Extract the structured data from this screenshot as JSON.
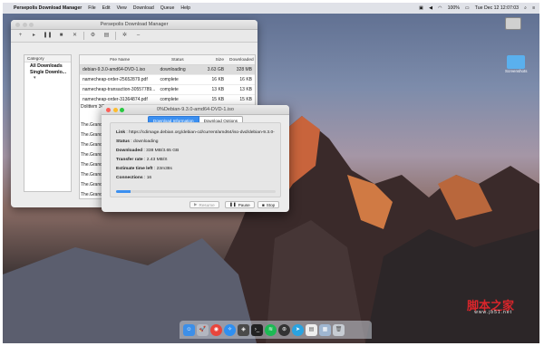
{
  "menubar": {
    "app": "Persepolis Download Manager",
    "items": [
      "File",
      "Edit",
      "View",
      "Download",
      "Queue",
      "Help"
    ],
    "battery": "100%",
    "clock": "Tue Dec 12  12:07:03"
  },
  "desktop": {
    "icons": [
      {
        "label": ""
      },
      {
        "label": "Screenshots"
      }
    ]
  },
  "main_window": {
    "title": "Persepolis Download Manager",
    "toolbar": [
      "add-icon",
      "resume-icon",
      "pause-icon",
      "stop-icon",
      "remove-icon",
      "properties-icon",
      "graph-icon",
      "settings-icon",
      "minimize-icon"
    ],
    "sidebar": {
      "header": "Category",
      "items": [
        "All Downloads",
        "Single Downlo..."
      ],
      "arrow": "▾"
    },
    "table": {
      "columns": [
        "File Name",
        "Status",
        "Size",
        "Downloaded"
      ],
      "rows": [
        {
          "name": "debian-9.3.0-amd64-DVD-1.iso",
          "status": "downloading",
          "size": "3.63 GB",
          "downloaded": "328 MB"
        },
        {
          "name": "namecheap-order-25652879.pdf",
          "status": "complete",
          "size": "16 KB",
          "downloaded": "16 KB"
        },
        {
          "name": "namecheap-transaction-30557789...",
          "status": "complete",
          "size": "13 KB",
          "downloaded": "13 KB"
        },
        {
          "name": "namecheap-order-31364874.pdf",
          "status": "complete",
          "size": "15 KB",
          "downloaded": "15 KB"
        }
      ],
      "partial_rows": [
        "Dolittem 3G...",
        "The.Grand.",
        "The.Grand.",
        "The.Grand.",
        "The.Grand.",
        "The.Grand.",
        "The.Grand.",
        "The.Grand.",
        "The.Grand."
      ]
    }
  },
  "dialog": {
    "title": "0%Debian-9.3.0-amd64-DVD-1.iso",
    "tabs": [
      "Download Information",
      "Download Options"
    ],
    "link_label": "Link",
    "link": "https://cdimage.debian.org/debian-cd/current/amd64/iso-dvd/debian-9.3.0-",
    "status_label": "Status",
    "status": "downloading",
    "downloaded_label": "Downloaded",
    "downloaded": "338 MB/3.65 GB",
    "rate_label": "Transfer rate",
    "rate": "2.43 MB/S",
    "eta_label": "Estimate time left",
    "eta": "23m38s",
    "connections_label": "Connections",
    "connections": "16",
    "progress": 0.09,
    "buttons": {
      "resume": "Resume",
      "pause": "Pause",
      "stop": "Stop"
    }
  },
  "dock": {
    "icons": [
      "finder-icon",
      "launchpad-icon",
      "chrome-icon",
      "safari-icon",
      "persepolis-icon",
      "terminal-icon",
      "spotify-icon",
      "github-icon",
      "telegram-icon",
      "document-icon",
      "folder-icon",
      "trash-icon"
    ]
  },
  "watermark": {
    "main": "脚本之家",
    "sub": "www.jb51.net"
  }
}
